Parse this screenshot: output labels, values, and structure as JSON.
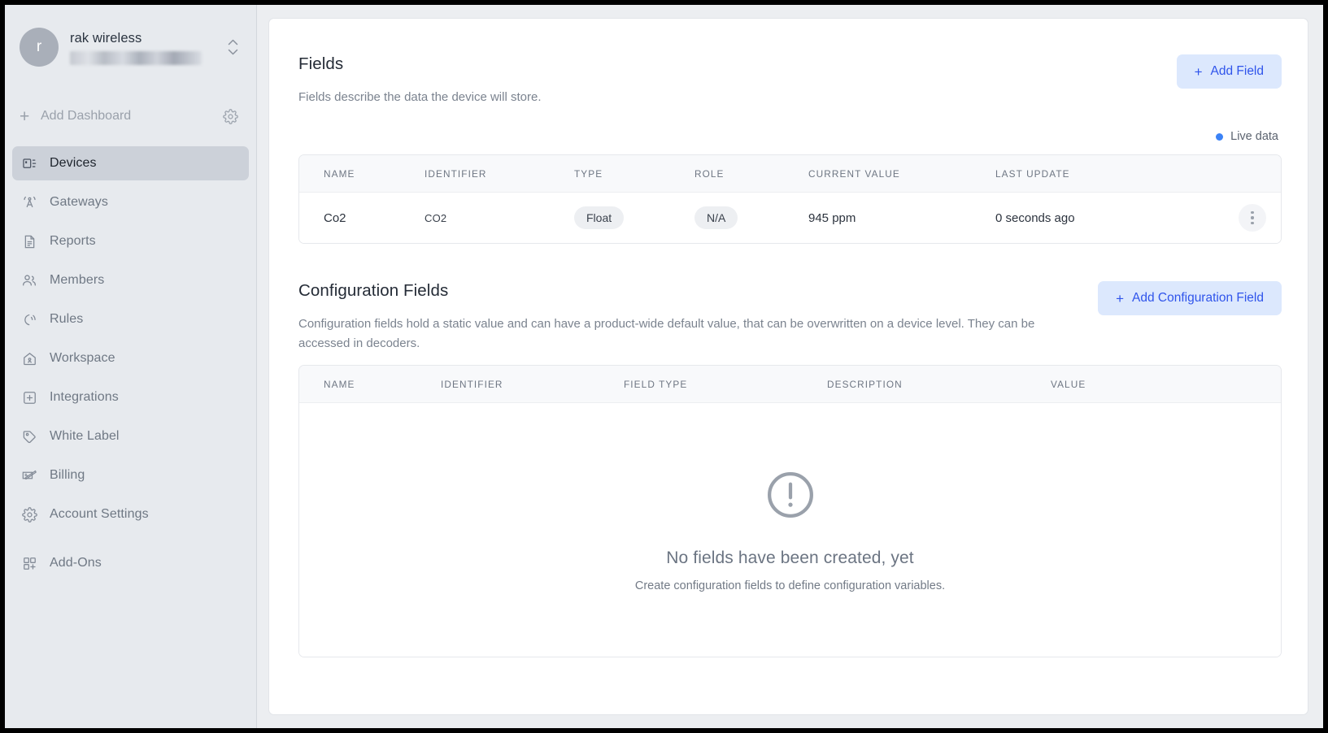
{
  "sidebar": {
    "workspace": {
      "avatar_letter": "r",
      "name": "rak wireless",
      "subtitle_redacted": ""
    },
    "add_dashboard": {
      "plus": "+",
      "label": "Add Dashboard"
    },
    "items": [
      {
        "label": "Devices",
        "icon": "devices-icon",
        "active": true
      },
      {
        "label": "Gateways",
        "icon": "gateway-antenna-icon",
        "active": false
      },
      {
        "label": "Reports",
        "icon": "report-document-icon",
        "active": false
      },
      {
        "label": "Members",
        "icon": "members-people-icon",
        "active": false
      },
      {
        "label": "Rules",
        "icon": "rules-signal-icon",
        "active": false
      },
      {
        "label": "Workspace",
        "icon": "workspace-home-icon",
        "active": false
      },
      {
        "label": "Integrations",
        "icon": "integrations-plus-box-icon",
        "active": false
      },
      {
        "label": "White Label",
        "icon": "tag-icon",
        "active": false
      },
      {
        "label": "Billing",
        "icon": "billing-check-icon",
        "active": false
      },
      {
        "label": "Account Settings",
        "icon": "gear-icon",
        "active": false
      },
      {
        "label": "Add-Ons",
        "icon": "addons-grid-icon",
        "active": false
      }
    ]
  },
  "fields_section": {
    "title": "Fields",
    "description": "Fields describe the data the device will store.",
    "add_button": {
      "plus": "+",
      "label": "Add Field"
    },
    "live_indicator": {
      "label": "Live data",
      "color": "#3b82f6"
    },
    "columns": [
      "NAME",
      "IDENTIFIER",
      "TYPE",
      "ROLE",
      "CURRENT VALUE",
      "LAST UPDATE"
    ],
    "rows": [
      {
        "name": "Co2",
        "identifier": "CO2",
        "type": "Float",
        "role": "N/A",
        "current_value": "945 ppm",
        "last_update": "0 seconds ago"
      }
    ]
  },
  "config_section": {
    "title": "Configuration Fields",
    "description": "Configuration fields hold a static value and can have a product-wide default value, that can be overwritten on a device level. They can be accessed in decoders.",
    "add_button": {
      "plus": "+",
      "label": "Add Configuration Field"
    },
    "columns": [
      "NAME",
      "IDENTIFIER",
      "FIELD TYPE",
      "DESCRIPTION",
      "VALUE"
    ],
    "empty_state": {
      "icon": "exclamation-circle-icon",
      "title": "No fields have been created, yet",
      "subtitle": "Create configuration fields to define configuration variables."
    }
  },
  "theme": {
    "accent_blue": "#2f54eb",
    "accent_blue_soft_bg": "#dce8fd",
    "sidebar_bg": "#e7eaee",
    "sidebar_active_bg": "#ccd1d9"
  }
}
